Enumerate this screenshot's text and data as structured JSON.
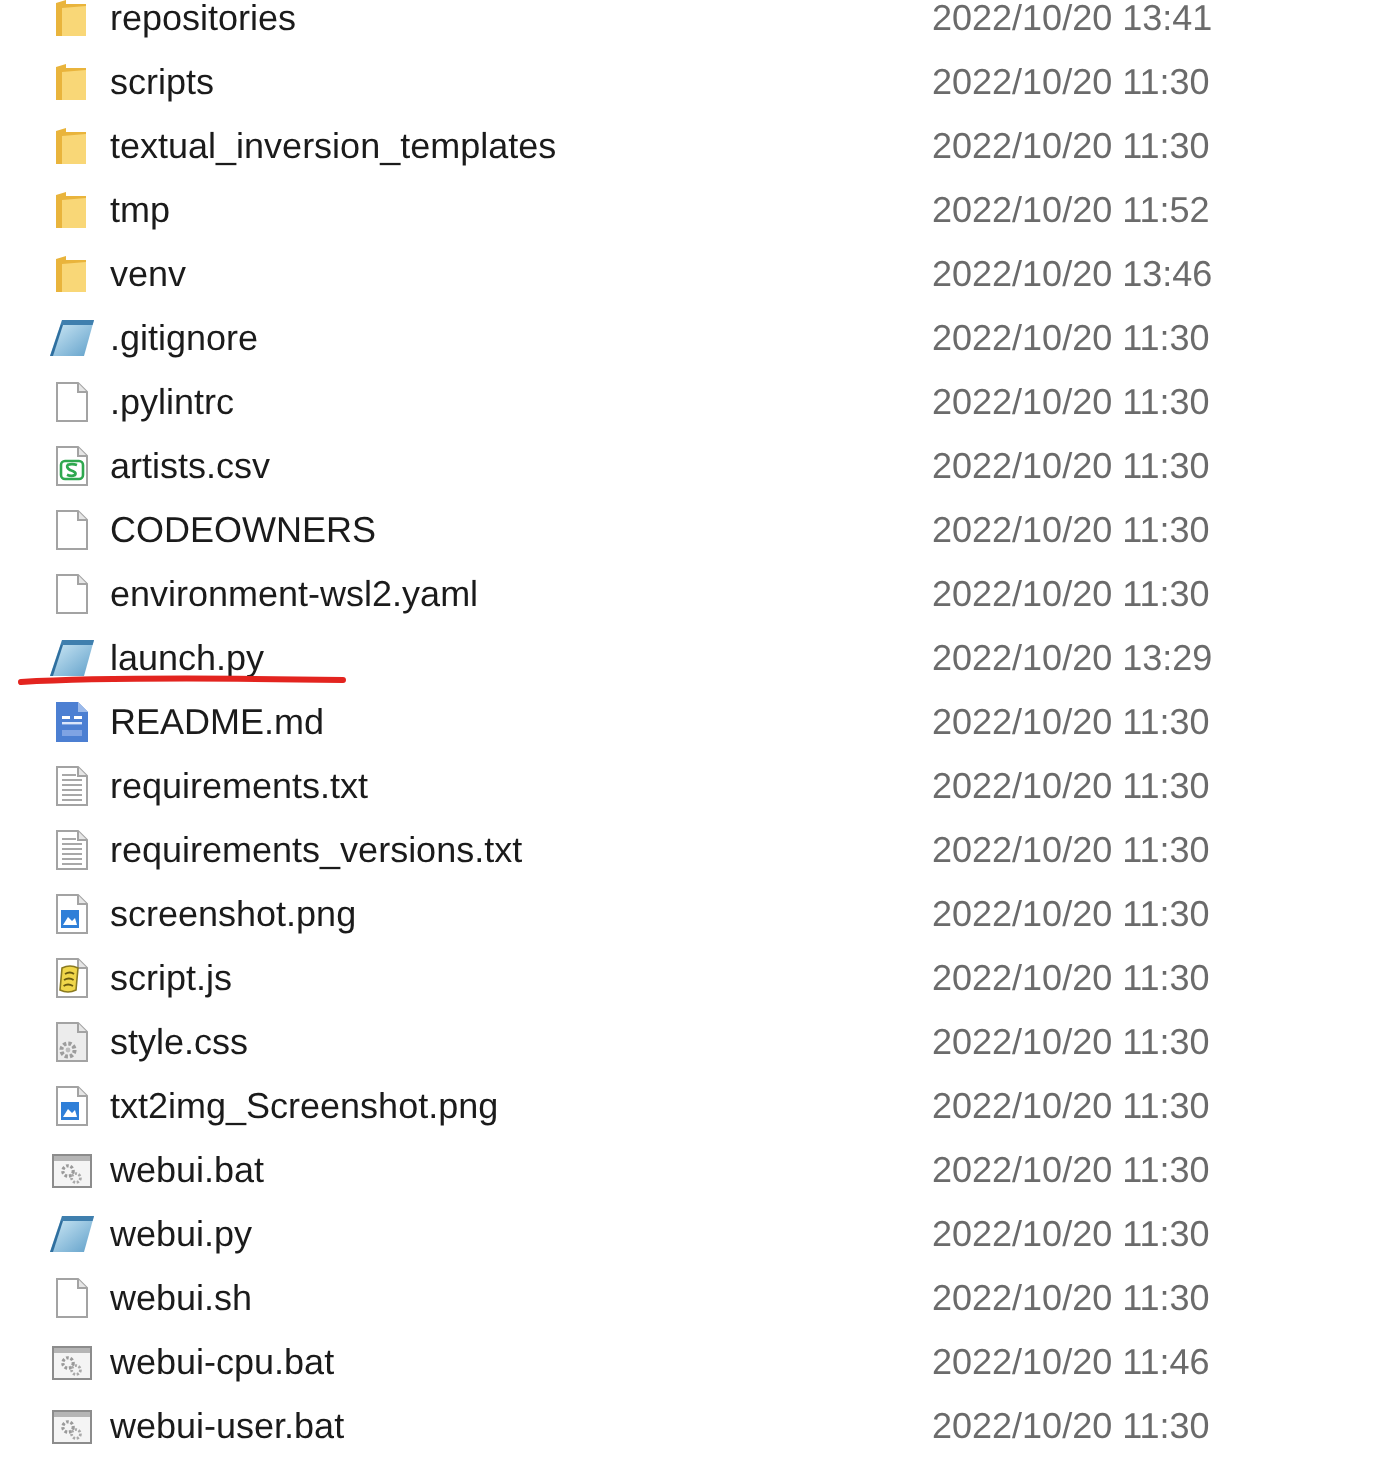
{
  "files": [
    {
      "name": "repositories",
      "modified": "2022/10/20 13:41",
      "kind": "folder",
      "underlined": false
    },
    {
      "name": "scripts",
      "modified": "2022/10/20 11:30",
      "kind": "folder",
      "underlined": false
    },
    {
      "name": "textual_inversion_templates",
      "modified": "2022/10/20 11:30",
      "kind": "folder",
      "underlined": false
    },
    {
      "name": "tmp",
      "modified": "2022/10/20 11:52",
      "kind": "folder",
      "underlined": false
    },
    {
      "name": "venv",
      "modified": "2022/10/20 13:46",
      "kind": "folder",
      "underlined": false
    },
    {
      "name": ".gitignore",
      "modified": "2022/10/20 11:30",
      "kind": "notepad",
      "underlined": false
    },
    {
      "name": ".pylintrc",
      "modified": "2022/10/20 11:30",
      "kind": "document",
      "underlined": false
    },
    {
      "name": "artists.csv",
      "modified": "2022/10/20 11:30",
      "kind": "spreadsheet",
      "underlined": false
    },
    {
      "name": "CODEOWNERS",
      "modified": "2022/10/20 11:30",
      "kind": "document",
      "underlined": false
    },
    {
      "name": "environment-wsl2.yaml",
      "modified": "2022/10/20 11:30",
      "kind": "document",
      "underlined": false
    },
    {
      "name": "launch.py",
      "modified": "2022/10/20 13:29",
      "kind": "notepad",
      "underlined": true
    },
    {
      "name": "README.md",
      "modified": "2022/10/20 11:30",
      "kind": "markdown",
      "underlined": false
    },
    {
      "name": "requirements.txt",
      "modified": "2022/10/20 11:30",
      "kind": "text",
      "underlined": false
    },
    {
      "name": "requirements_versions.txt",
      "modified": "2022/10/20 11:30",
      "kind": "text",
      "underlined": false
    },
    {
      "name": "screenshot.png",
      "modified": "2022/10/20 11:30",
      "kind": "image",
      "underlined": false
    },
    {
      "name": "script.js",
      "modified": "2022/10/20 11:30",
      "kind": "script",
      "underlined": false
    },
    {
      "name": "style.css",
      "modified": "2022/10/20 11:30",
      "kind": "stylesheet",
      "underlined": false
    },
    {
      "name": "txt2img_Screenshot.png",
      "modified": "2022/10/20 11:30",
      "kind": "image",
      "underlined": false
    },
    {
      "name": "webui.bat",
      "modified": "2022/10/20 11:30",
      "kind": "batch",
      "underlined": false
    },
    {
      "name": "webui.py",
      "modified": "2022/10/20 11:30",
      "kind": "notepad",
      "underlined": false
    },
    {
      "name": "webui.sh",
      "modified": "2022/10/20 11:30",
      "kind": "document",
      "underlined": false
    },
    {
      "name": "webui-cpu.bat",
      "modified": "2022/10/20 11:46",
      "kind": "batch",
      "underlined": false
    },
    {
      "name": "webui-user.bat",
      "modified": "2022/10/20 11:30",
      "kind": "batch",
      "underlined": false
    }
  ]
}
